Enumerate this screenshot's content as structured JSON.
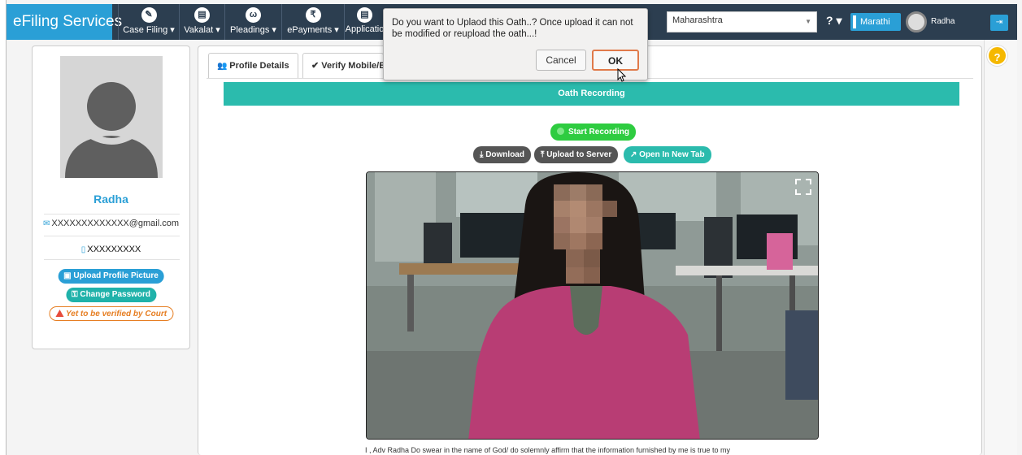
{
  "navbar": {
    "brand": "eFiling Services",
    "items": [
      {
        "icon": "case-filing-icon",
        "glyph": "✎",
        "label": "Case Filing ▾"
      },
      {
        "icon": "vakalat-icon",
        "glyph": "▤",
        "label": "Vakalat ▾"
      },
      {
        "icon": "pleadings-icon",
        "glyph": "ω",
        "label": "Pleadings ▾"
      },
      {
        "icon": "epayments-icon",
        "glyph": "₹",
        "label": "ePayments ▾"
      },
      {
        "icon": "application-icon",
        "glyph": "▤",
        "label": "Applicatio"
      }
    ],
    "state_value": "Maharashtra",
    "help_label": "? ▾",
    "language": "Marathi",
    "user_name": "Radha",
    "logout_glyph": "⇥"
  },
  "profile": {
    "name": "Radha",
    "email": "XXXXXXXXXXXXX@gmail.com",
    "phone": "XXXXXXXXX",
    "upload_picture": "Upload Profile Picture",
    "change_password": "Change Password",
    "verification_status": "Yet to be verified by Court"
  },
  "tabs": [
    {
      "label": "Profile Details",
      "glyph": "👥"
    },
    {
      "label": "Verify Mobile/E",
      "glyph": "✔"
    }
  ],
  "oath": {
    "title": "Oath Recording",
    "start_recording": "Start Recording",
    "download": "Download",
    "upload_to_server": "Upload to Server",
    "open_in_new_tab": "Open In New Tab",
    "caption": "I , Adv Radha Do swear in the name of God/ do solemnly affirm that the information furnished by me is true to my"
  },
  "dialog": {
    "message": "Do you want to Uplaod this Oath..? Once upload it can not be modified or reupload the oath...!",
    "cancel": "Cancel",
    "ok": "OK"
  },
  "help_badge": "?",
  "colors": {
    "navbar": "#2c3e50",
    "brand": "#2a9fd6",
    "teal": "#2bbbad",
    "green": "#2ecc40",
    "warning": "#e67e22"
  }
}
